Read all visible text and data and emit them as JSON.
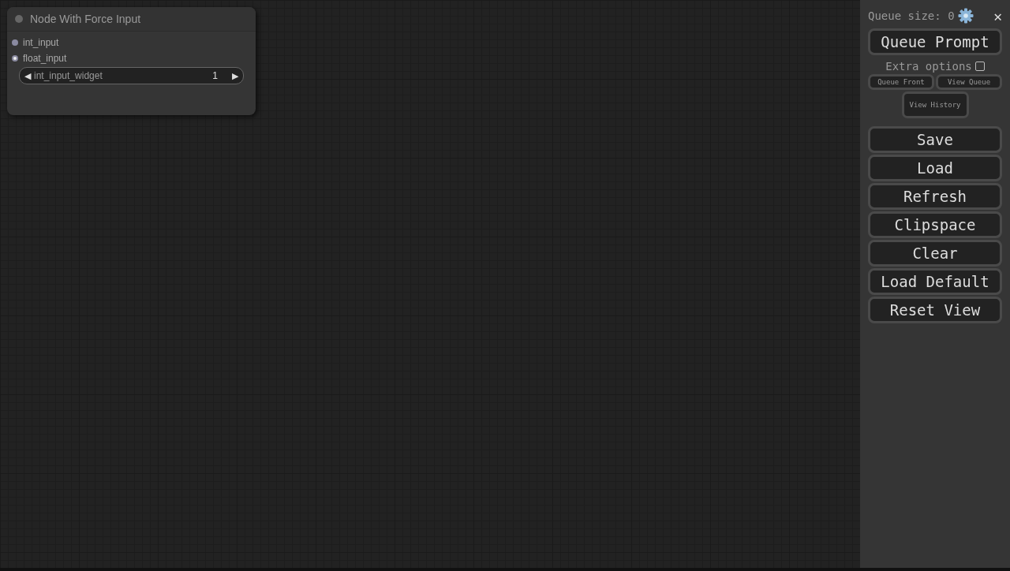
{
  "node": {
    "title": "Node With Force Input",
    "inputs": [
      {
        "name": "int_input",
        "kind": "filled"
      },
      {
        "name": "float_input",
        "kind": "ring"
      }
    ],
    "widget": {
      "label": "int_input_widget",
      "value": "1",
      "left": "◀",
      "right": "▶"
    }
  },
  "menu": {
    "queue_size": "Queue size: 0",
    "close": "✕",
    "queue_prompt": "Queue Prompt",
    "extra_options": {
      "label": "Extra options",
      "checked": false
    },
    "small_buttons": [
      "Queue Front",
      "View Queue"
    ],
    "history_button": "View History",
    "buttons": [
      "Save",
      "Load",
      "Refresh",
      "Clipspace",
      "Clear",
      "Load Default",
      "Reset View"
    ]
  }
}
